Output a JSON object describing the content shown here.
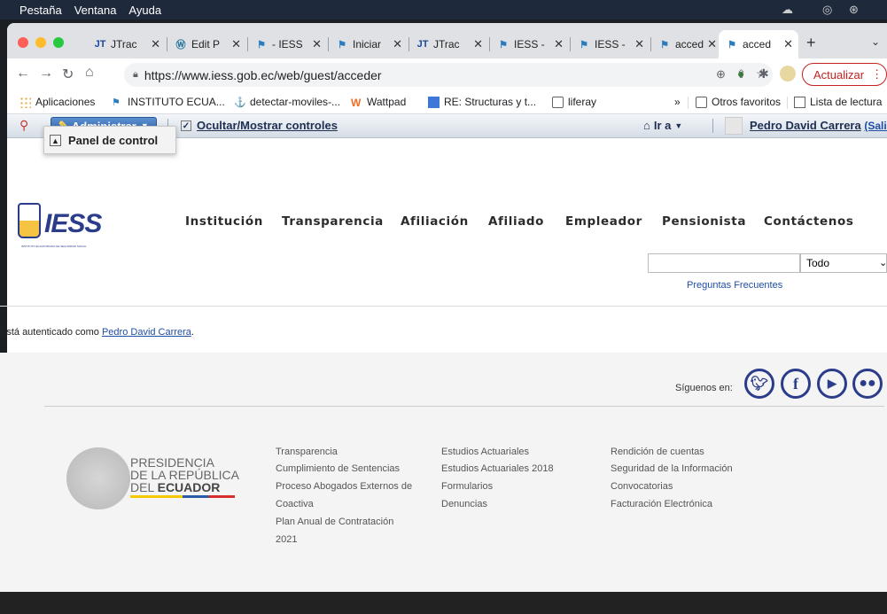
{
  "menubar": {
    "items": [
      "Pestaña",
      "Ventana",
      "Ayuda"
    ]
  },
  "tabs": [
    {
      "label": "JTrac",
      "icon": "jtrac-icon"
    },
    {
      "label": "Edit P",
      "icon": "wordpress-icon"
    },
    {
      "label": "- IESS",
      "icon": "iess-icon"
    },
    {
      "label": "Iniciar",
      "icon": "iess-icon"
    },
    {
      "label": "JTrac",
      "icon": "jtrac-icon"
    },
    {
      "label": "IESS -",
      "icon": "iess-icon"
    },
    {
      "label": "IESS -",
      "icon": "iess-icon"
    },
    {
      "label": "acced",
      "icon": "iess-icon"
    },
    {
      "label": "acced",
      "icon": "iess-icon",
      "active": true
    }
  ],
  "toolbar": {
    "url": "https://www.iess.gob.ec/web/guest/acceder",
    "update_label": "Actualizar"
  },
  "bookmarks": {
    "apps": "Aplicaciones",
    "items": [
      "INSTITUTO ECUA...",
      "detectar-moviles-...",
      "Wattpad",
      "RE: Structuras y t...",
      "liferay"
    ],
    "more": "»",
    "other": "Otros favoritos",
    "reading_list": "Lista de lectura"
  },
  "dockbar": {
    "admin": "Administrar",
    "toggle_controls": "Ocultar/Mostrar controles",
    "goto": "Ir a",
    "user": "Pedro David Carrera",
    "logout": "(Salir"
  },
  "dropdown": {
    "control_panel": "Panel de control"
  },
  "site": {
    "logo": "IESS",
    "logo_sub": "INSTITUTO ECUATORIANO DE SEGURIDAD SOCIAL",
    "nav": [
      "Institución",
      "Transparencia",
      "Afiliación",
      "Afiliado",
      "Empleador",
      "Pensionista",
      "Contáctenos"
    ],
    "search_scope": "Todo",
    "faq": "Preguntas Frecuentes",
    "auth_prefix": "Está autenticado como",
    "auth_user": "Pedro David Carrera",
    "auth_suffix": "."
  },
  "footer": {
    "follow": "Síguenos en:",
    "gov_line1": "PRESIDENCIA",
    "gov_line2": "DE LA REPÚBLICA",
    "gov_line3_prefix": "DEL",
    "gov_line3_bold": "ECUADOR",
    "col1": [
      "Transparencia",
      "Cumplimiento de Sentencias",
      "Proceso Abogados Externos de",
      "Coactiva",
      "Plan Anual de Contratación",
      "2021"
    ],
    "col2": [
      "Estudios Actuariales",
      "Estudios Actuariales 2018",
      "Formularios",
      "Denuncias"
    ],
    "col3": [
      "Rendición de cuentas",
      "Seguridad de la Información",
      "Convocatorias",
      "Facturación Electrónica"
    ]
  },
  "colors": {
    "accent": "#2b3d8a",
    "link": "#1f4ea3",
    "update": "#c5221f"
  }
}
